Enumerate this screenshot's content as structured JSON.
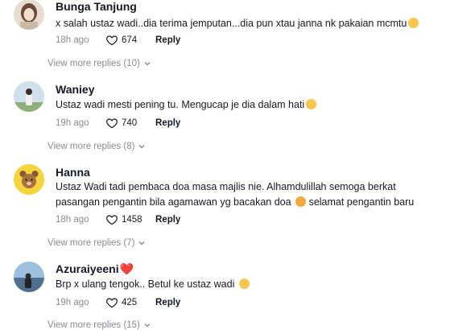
{
  "comments": [
    {
      "username": "Bunga Tanjung",
      "text": "x salah ustaz wadi..dia terima jemputan...dia pun xtau janna nk pakaian mcmtu",
      "time": "18h ago",
      "likes": "674",
      "reply": "Reply",
      "view_more": "View more replies (10)",
      "emoji": "grinning-face",
      "avatar_color": "#d9c7b8"
    },
    {
      "username": "Waniey",
      "text": "Ustaz wadi mesti pening tu. Mengucap je dia dalam hati",
      "time": "19h ago",
      "likes": "740",
      "reply": "Reply",
      "view_more": "View more replies (8)",
      "emoji": "tears-of-joy",
      "avatar_color": "#b8c9d6"
    },
    {
      "username": "Hanna",
      "text_line1": "Ustaz Wadi tadi pembaca doa masa majlis nie. Alhamdulillah semoga berkat",
      "text_line2": "pasangan pengantin bila agamawan yg bacakan doa",
      "text_line2_after": "selamat pengantin baru",
      "time": "18h ago",
      "likes": "1458",
      "reply": "Reply",
      "view_more": "View more replies (7)",
      "emoji": "smiling-face-with-hearts",
      "avatar_color": "#f5d33a"
    },
    {
      "username": "Azuraiyeeni",
      "username_suffix": "❤️",
      "text": "Brp x ulang tengok.. Betul ke ustaz wadi",
      "time": "19h ago",
      "likes": "425",
      "reply": "Reply",
      "view_more": "View more replies (15)",
      "emoji": "smiling-face",
      "avatar_color": "#7fa6c8"
    }
  ]
}
